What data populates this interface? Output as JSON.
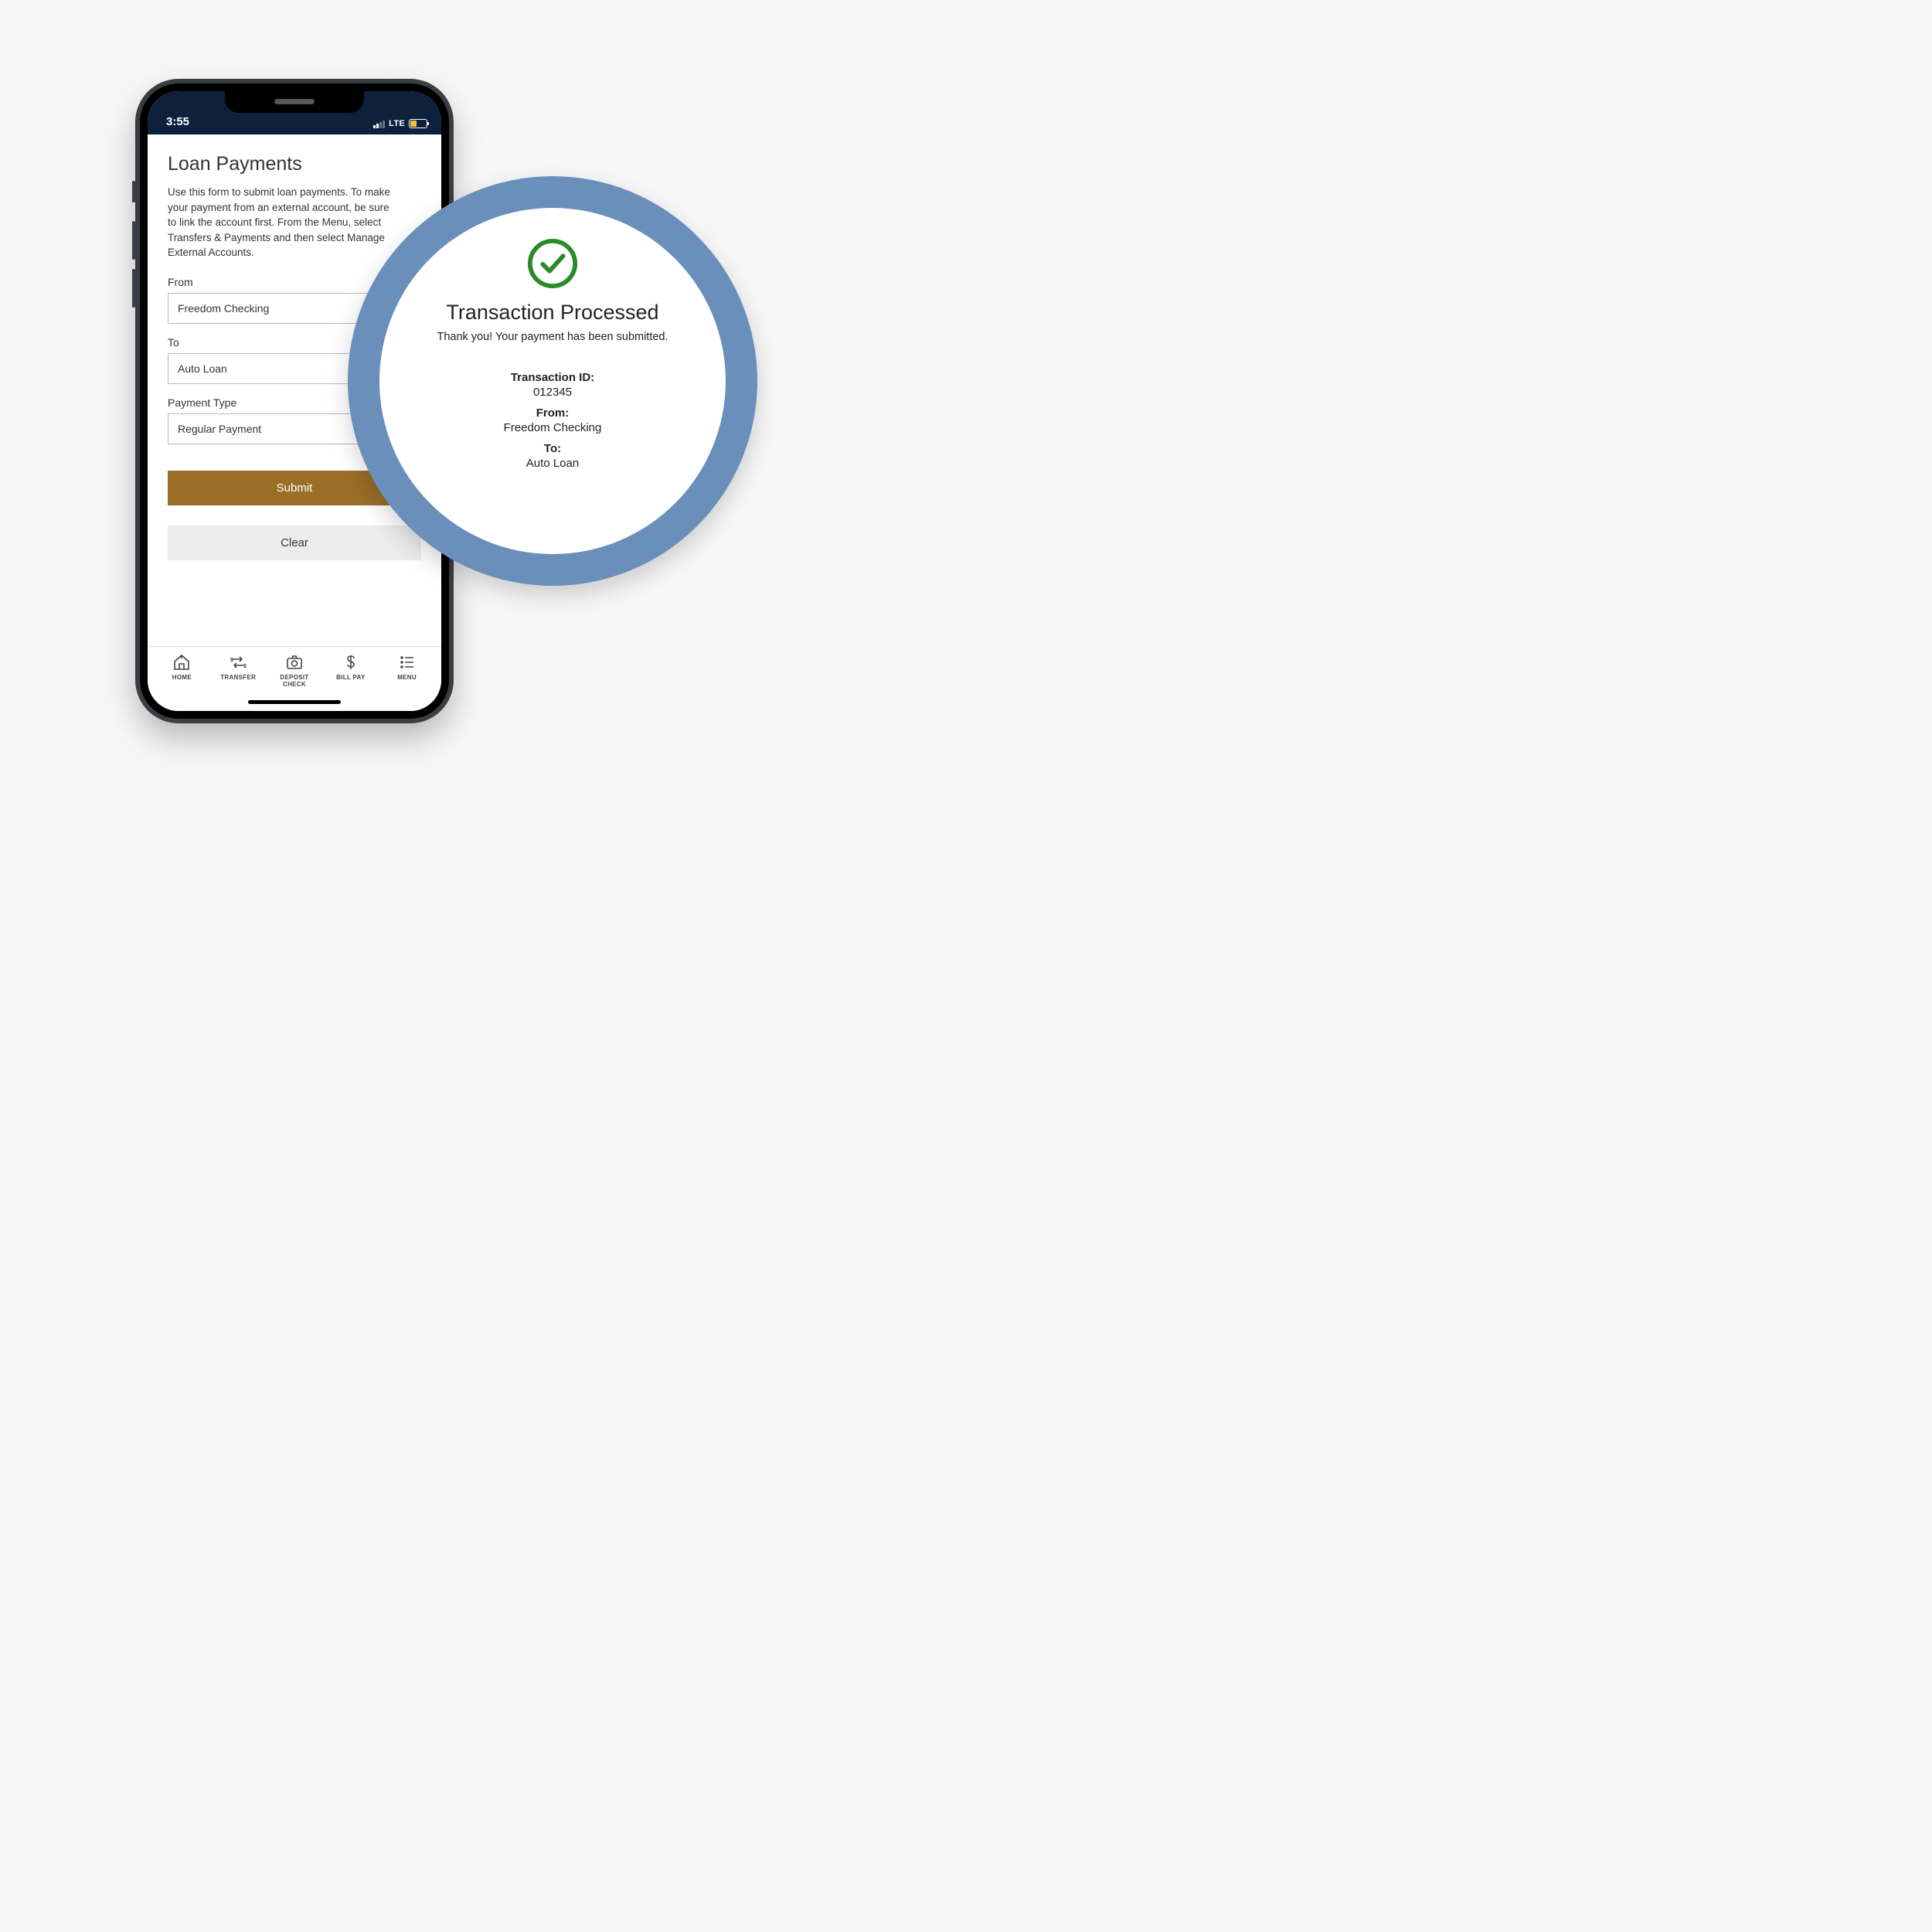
{
  "statusBar": {
    "time": "3:55",
    "network": "LTE"
  },
  "page": {
    "title": "Loan Payments",
    "description": "Use this form to submit loan payments. To make your payment from an external account, be sure to link the account first. From the Menu, select Transfers & Payments and then select Manage External Accounts."
  },
  "form": {
    "fromLabel": "From",
    "fromValue": "Freedom Checking",
    "toLabel": "To",
    "toValue": "Auto Loan",
    "paymentTypeLabel": "Payment Type",
    "paymentTypeValue": "Regular Payment",
    "submitLabel": "Submit",
    "clearLabel": "Clear"
  },
  "tabs": {
    "home": "HOME",
    "transfer": "TRANSFER",
    "deposit": "DEPOSIT CHECK",
    "billpay": "BILL PAY",
    "menu": "MENU"
  },
  "callout": {
    "title": "Transaction Processed",
    "subtitle": "Thank you! Your payment has been submitted.",
    "transactionIdLabel": "Transaction ID:",
    "transactionIdValue": "012345",
    "fromLabel": "From:",
    "fromValue": "Freedom Checking",
    "toLabel": "To:",
    "toValue": "Auto Loan"
  }
}
